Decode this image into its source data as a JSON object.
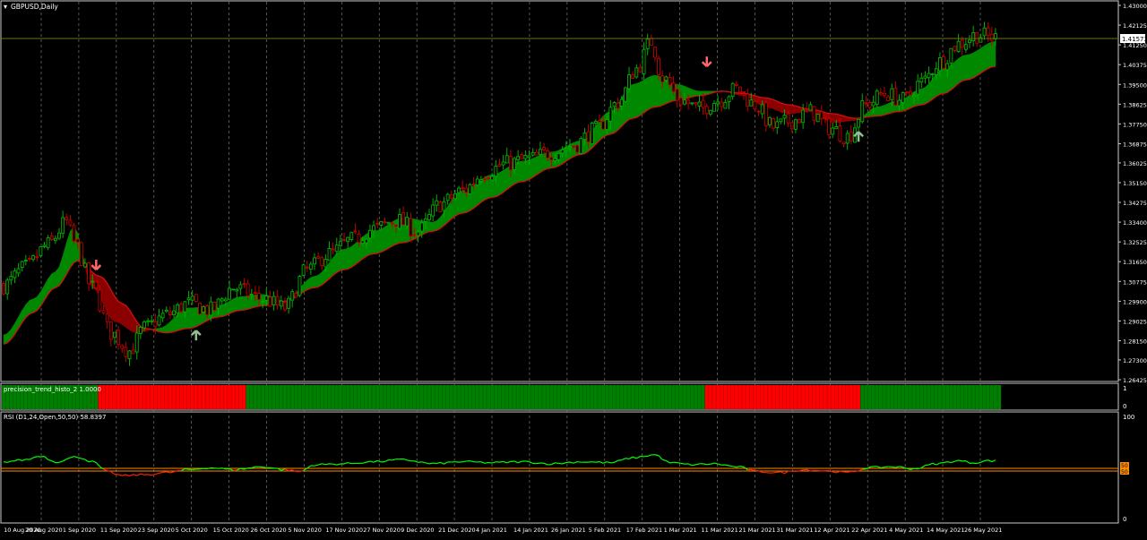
{
  "main_chart": {
    "title": "GBPUSD,Daily",
    "current_price": "1.41573",
    "price_ticks": [
      "1.43000",
      "1.42125",
      "1.41250",
      "1.40375",
      "1.39500",
      "1.38625",
      "1.37750",
      "1.36875",
      "1.36025",
      "1.35150",
      "1.34275",
      "1.33400",
      "1.32525",
      "1.31650",
      "1.30775",
      "1.29900",
      "1.29025",
      "1.28150",
      "1.27300",
      "1.26425"
    ]
  },
  "histogram": {
    "title": "precision_trend_histo_2 1.0000",
    "scale_top": "1",
    "scale_bottom": "0",
    "segments": [
      {
        "from": 0,
        "to": 26,
        "color": "green"
      },
      {
        "from": 26,
        "to": 66,
        "color": "red"
      },
      {
        "from": 66,
        "to": 190,
        "color": "green"
      },
      {
        "from": 190,
        "to": 232,
        "color": "red"
      },
      {
        "from": 232,
        "to": 270,
        "color": "green"
      }
    ]
  },
  "rsi": {
    "title": "RSI (D1,24,Open,50,50) 58.8397",
    "scale_top": "100",
    "scale_bottom": "0",
    "levels": [
      "50",
      "50"
    ]
  },
  "time_axis": [
    "10 Aug 2020",
    "20 Aug 2020",
    "1 Sep 2020",
    "11 Sep 2020",
    "23 Sep 2020",
    "5 Oct 2020",
    "15 Oct 2020",
    "26 Oct 2020",
    "5 Nov 2020",
    "17 Nov 2020",
    "27 Nov 2020",
    "9 Dec 2020",
    "21 Dec 2020",
    "4 Jan 2021",
    "14 Jan 2021",
    "26 Jan 2021",
    "5 Feb 2021",
    "17 Feb 2021",
    "1 Mar 2021",
    "11 Mar 2021",
    "21 Mar 2021",
    "31 Mar 2021",
    "12 Apr 2021",
    "22 Apr 2021",
    "4 May 2021",
    "14 May 2021",
    "26 May 2021"
  ],
  "colors": {
    "background": "#000000",
    "bull": "#00b000",
    "bear": "#c00000",
    "band_up": "#008800",
    "band_down": "#8b0000",
    "histo_green": "#008000",
    "histo_red": "#ff0000",
    "rsi_up": "#00ff00",
    "rsi_down": "#ff2200",
    "level": "#ff8c00",
    "arrow_up": "#90c090",
    "arrow_down": "#ff6666"
  },
  "chart_data": {
    "type": "candlestick",
    "instrument": "GBPUSD",
    "timeframe": "Daily",
    "close_anchors": [
      [
        0,
        1.306
      ],
      [
        6,
        1.314
      ],
      [
        12,
        1.324
      ],
      [
        17,
        1.334
      ],
      [
        19,
        1.325
      ],
      [
        24,
        1.305
      ],
      [
        29,
        1.285
      ],
      [
        34,
        1.277
      ],
      [
        38,
        1.287
      ],
      [
        44,
        1.293
      ],
      [
        50,
        1.298
      ],
      [
        56,
        1.295
      ],
      [
        62,
        1.305
      ],
      [
        70,
        1.3
      ],
      [
        76,
        1.296
      ],
      [
        82,
        1.313
      ],
      [
        88,
        1.32
      ],
      [
        94,
        1.326
      ],
      [
        100,
        1.331
      ],
      [
        106,
        1.335
      ],
      [
        112,
        1.33
      ],
      [
        118,
        1.342
      ],
      [
        124,
        1.348
      ],
      [
        130,
        1.356
      ],
      [
        136,
        1.36
      ],
      [
        142,
        1.362
      ],
      [
        148,
        1.365
      ],
      [
        154,
        1.368
      ],
      [
        160,
        1.375
      ],
      [
        166,
        1.387
      ],
      [
        171,
        1.402
      ],
      [
        175,
        1.414
      ],
      [
        178,
        1.398
      ],
      [
        183,
        1.388
      ],
      [
        188,
        1.384
      ],
      [
        193,
        1.388
      ],
      [
        198,
        1.393
      ],
      [
        203,
        1.386
      ],
      [
        208,
        1.376
      ],
      [
        213,
        1.379
      ],
      [
        218,
        1.383
      ],
      [
        223,
        1.376
      ],
      [
        228,
        1.372
      ],
      [
        233,
        1.386
      ],
      [
        238,
        1.391
      ],
      [
        243,
        1.388
      ],
      [
        248,
        1.396
      ],
      [
        253,
        1.405
      ],
      [
        258,
        1.413
      ],
      [
        263,
        1.417
      ],
      [
        268,
        1.4157
      ]
    ],
    "fast_ma_anchors": [
      [
        0,
        1.284
      ],
      [
        8,
        1.3
      ],
      [
        14,
        1.312
      ],
      [
        19,
        1.332
      ],
      [
        24,
        1.305
      ],
      [
        30,
        1.29
      ],
      [
        36,
        1.285
      ],
      [
        42,
        1.287
      ],
      [
        50,
        1.296
      ],
      [
        58,
        1.297
      ],
      [
        64,
        1.301
      ],
      [
        70,
        1.302
      ],
      [
        76,
        1.299
      ],
      [
        84,
        1.31
      ],
      [
        92,
        1.322
      ],
      [
        100,
        1.33
      ],
      [
        108,
        1.336
      ],
      [
        116,
        1.334
      ],
      [
        124,
        1.348
      ],
      [
        132,
        1.355
      ],
      [
        140,
        1.361
      ],
      [
        148,
        1.365
      ],
      [
        156,
        1.37
      ],
      [
        164,
        1.383
      ],
      [
        170,
        1.395
      ],
      [
        176,
        1.399
      ],
      [
        182,
        1.395
      ],
      [
        188,
        1.392
      ],
      [
        194,
        1.392
      ],
      [
        200,
        1.39
      ],
      [
        206,
        1.385
      ],
      [
        212,
        1.382
      ],
      [
        218,
        1.383
      ],
      [
        224,
        1.378
      ],
      [
        230,
        1.379
      ],
      [
        236,
        1.385
      ],
      [
        242,
        1.388
      ],
      [
        248,
        1.393
      ],
      [
        254,
        1.402
      ],
      [
        260,
        1.408
      ],
      [
        268,
        1.414
      ]
    ],
    "slow_ma_anchors": [
      [
        0,
        1.28
      ],
      [
        8,
        1.294
      ],
      [
        14,
        1.305
      ],
      [
        20,
        1.317
      ],
      [
        26,
        1.31
      ],
      [
        32,
        1.298
      ],
      [
        38,
        1.287
      ],
      [
        44,
        1.285
      ],
      [
        50,
        1.287
      ],
      [
        58,
        1.292
      ],
      [
        64,
        1.295
      ],
      [
        70,
        1.297
      ],
      [
        76,
        1.299
      ],
      [
        84,
        1.305
      ],
      [
        92,
        1.313
      ],
      [
        100,
        1.32
      ],
      [
        108,
        1.325
      ],
      [
        116,
        1.33
      ],
      [
        124,
        1.338
      ],
      [
        132,
        1.345
      ],
      [
        140,
        1.352
      ],
      [
        148,
        1.358
      ],
      [
        156,
        1.364
      ],
      [
        164,
        1.373
      ],
      [
        170,
        1.38
      ],
      [
        176,
        1.385
      ],
      [
        182,
        1.388
      ],
      [
        188,
        1.39
      ],
      [
        194,
        1.392
      ],
      [
        200,
        1.391
      ],
      [
        206,
        1.389
      ],
      [
        212,
        1.386
      ],
      [
        218,
        1.384
      ],
      [
        224,
        1.382
      ],
      [
        230,
        1.38
      ],
      [
        236,
        1.381
      ],
      [
        242,
        1.383
      ],
      [
        248,
        1.386
      ],
      [
        254,
        1.391
      ],
      [
        260,
        1.397
      ],
      [
        268,
        1.403
      ]
    ],
    "rsi_anchors": [
      [
        0,
        58
      ],
      [
        6,
        60
      ],
      [
        10,
        64
      ],
      [
        14,
        58
      ],
      [
        20,
        63
      ],
      [
        24,
        58
      ],
      [
        28,
        48
      ],
      [
        32,
        44
      ],
      [
        38,
        45
      ],
      [
        44,
        47
      ],
      [
        50,
        50
      ],
      [
        56,
        52
      ],
      [
        62,
        50
      ],
      [
        70,
        53
      ],
      [
        76,
        50
      ],
      [
        80,
        48
      ],
      [
        84,
        55
      ],
      [
        92,
        56
      ],
      [
        100,
        58
      ],
      [
        108,
        60
      ],
      [
        116,
        56
      ],
      [
        124,
        58
      ],
      [
        132,
        57
      ],
      [
        140,
        58
      ],
      [
        148,
        56
      ],
      [
        156,
        58
      ],
      [
        164,
        57
      ],
      [
        170,
        62
      ],
      [
        176,
        65
      ],
      [
        180,
        57
      ],
      [
        186,
        55
      ],
      [
        192,
        56
      ],
      [
        198,
        53
      ],
      [
        204,
        48
      ],
      [
        210,
        47
      ],
      [
        216,
        50
      ],
      [
        222,
        49
      ],
      [
        228,
        47
      ],
      [
        234,
        52
      ],
      [
        240,
        53
      ],
      [
        246,
        51
      ],
      [
        252,
        56
      ],
      [
        258,
        59
      ],
      [
        262,
        57
      ],
      [
        266,
        59
      ],
      [
        268,
        58.84
      ]
    ],
    "arrows": [
      {
        "type": "down",
        "bar": 25,
        "price": 1.313
      },
      {
        "type": "up",
        "bar": 52,
        "price": 1.286
      },
      {
        "type": "down",
        "bar": 190,
        "price": 1.403
      },
      {
        "type": "up",
        "bar": 231,
        "price": 1.374
      }
    ],
    "ylim": [
      1.26425,
      1.43
    ],
    "rsi_ylim": [
      0,
      100
    ],
    "histogram_ylim": [
      0,
      1
    ]
  }
}
